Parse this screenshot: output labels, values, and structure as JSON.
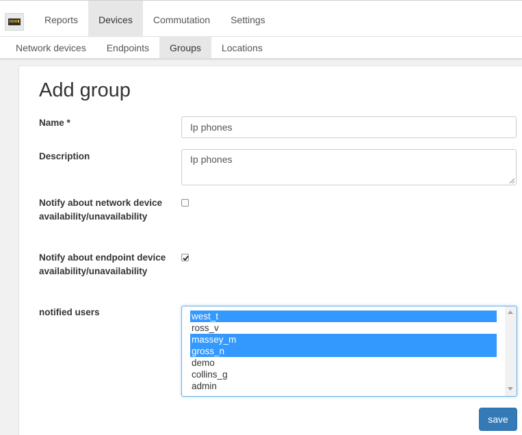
{
  "logo": {
    "icon": "network-port-icon"
  },
  "nav": {
    "items": [
      {
        "label": "Reports"
      },
      {
        "label": "Devices"
      },
      {
        "label": "Commutation"
      },
      {
        "label": "Settings"
      }
    ],
    "active": "Devices"
  },
  "subnav": {
    "items": [
      {
        "label": "Network devices"
      },
      {
        "label": "Endpoints"
      },
      {
        "label": "Groups"
      },
      {
        "label": "Locations"
      }
    ],
    "active": "Groups"
  },
  "form": {
    "title": "Add group",
    "name_label": "Name *",
    "name_value": "Ip phones",
    "description_label": "Description",
    "description_value": "Ip phones",
    "notify_network_label": "Notify about network device availability/unavailability",
    "notify_network_checked": false,
    "notify_endpoint_label": "Notify about endpoint device availability/unavailability",
    "notify_endpoint_checked": true,
    "notified_users_label": "notified users",
    "users": [
      {
        "name": "west_t",
        "selected": true
      },
      {
        "name": "ross_v",
        "selected": false
      },
      {
        "name": "massey_m",
        "selected": true
      },
      {
        "name": "gross_n",
        "selected": true
      },
      {
        "name": "demo",
        "selected": false
      },
      {
        "name": "collins_g",
        "selected": false
      },
      {
        "name": "admin",
        "selected": false
      }
    ],
    "save_label": "save"
  },
  "colors": {
    "primary": "#337ab7",
    "selection": "#3399ff",
    "active_tab": "#e7e7e7"
  }
}
